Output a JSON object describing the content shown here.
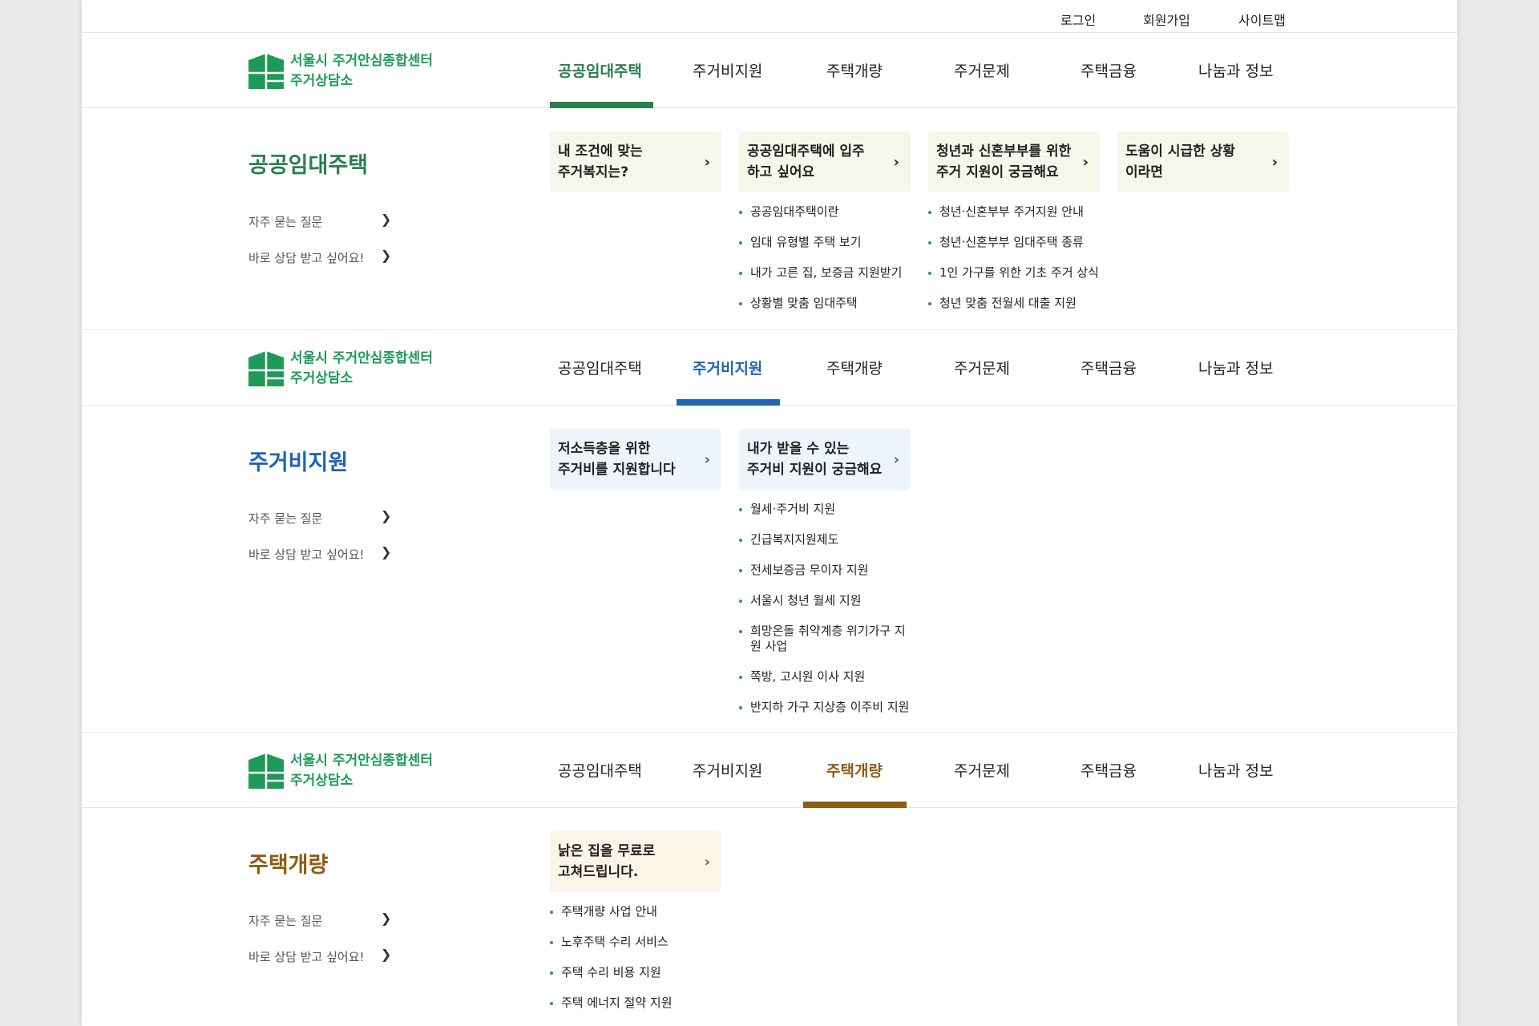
{
  "util_links": [
    "로그인",
    "회원가입",
    "사이트맵"
  ],
  "logo": {
    "line1": "서울시 주거안심종합센터",
    "line2": "주거상담소"
  },
  "nav": [
    "공공임대주택",
    "주거비지원",
    "주택개량",
    "주거문제",
    "주택금융",
    "나눔과 정보"
  ],
  "side_links": [
    "자주 묻는 질문",
    "바로 상담 받고 싶어요!"
  ],
  "colors": {
    "green": "#2e7d4f",
    "blue": "#1f64b6",
    "brown": "#8e5b14",
    "logo_green": "#1e9a57",
    "bullet": "#2e9a5a"
  },
  "panels": [
    {
      "title": "공공임대주택",
      "cards": [
        {
          "lines": [
            "내 조건에 맞는",
            "주거복지는?"
          ],
          "items": []
        },
        {
          "lines": [
            "공공임대주택에 입주",
            "하고 싶어요"
          ],
          "items": [
            "공공임대주택이란",
            "임대 유형별 주택 보기",
            "내가 고른 집, 보증금 지원받기",
            "상황별 맞춤 임대주택"
          ]
        },
        {
          "lines": [
            "청년과 신혼부부를 위한",
            "주거 지원이 궁금해요"
          ],
          "items": [
            "청년·신혼부부 주거지원 안내",
            "청년·신혼부부 임대주택 종류",
            "1인 가구를 위한 기초 주거 상식",
            "청년 맞춤 전월세 대출 지원"
          ]
        },
        {
          "lines": [
            "도움이 시급한 상황",
            "이라면"
          ],
          "items": []
        }
      ]
    },
    {
      "title": "주거비지원",
      "cards": [
        {
          "lines": [
            "저소득층을 위한",
            "주거비를 지원합니다"
          ],
          "items": []
        },
        {
          "lines": [
            "내가 받을 수 있는",
            "주거비 지원이 궁금해요"
          ],
          "items": [
            "월세·주거비 지원",
            "긴급복지지원제도",
            "전세보증금 무이자 지원",
            "서울시 청년 월세 지원",
            "희망온돌 취약계층 위기가구 지원 사업",
            "쪽방, 고시원 이사 지원",
            "반지하 가구 지상층 이주비 지원"
          ]
        }
      ]
    },
    {
      "title": "주택개량",
      "cards": [
        {
          "lines": [
            "낡은 집을 무료로",
            "고쳐드립니다."
          ],
          "items": [
            "주택개량 사업 안내",
            "노후주택 수리 서비스",
            "주택 수리 비용 지원",
            "주택 에너지 절약 지원"
          ]
        }
      ]
    }
  ]
}
